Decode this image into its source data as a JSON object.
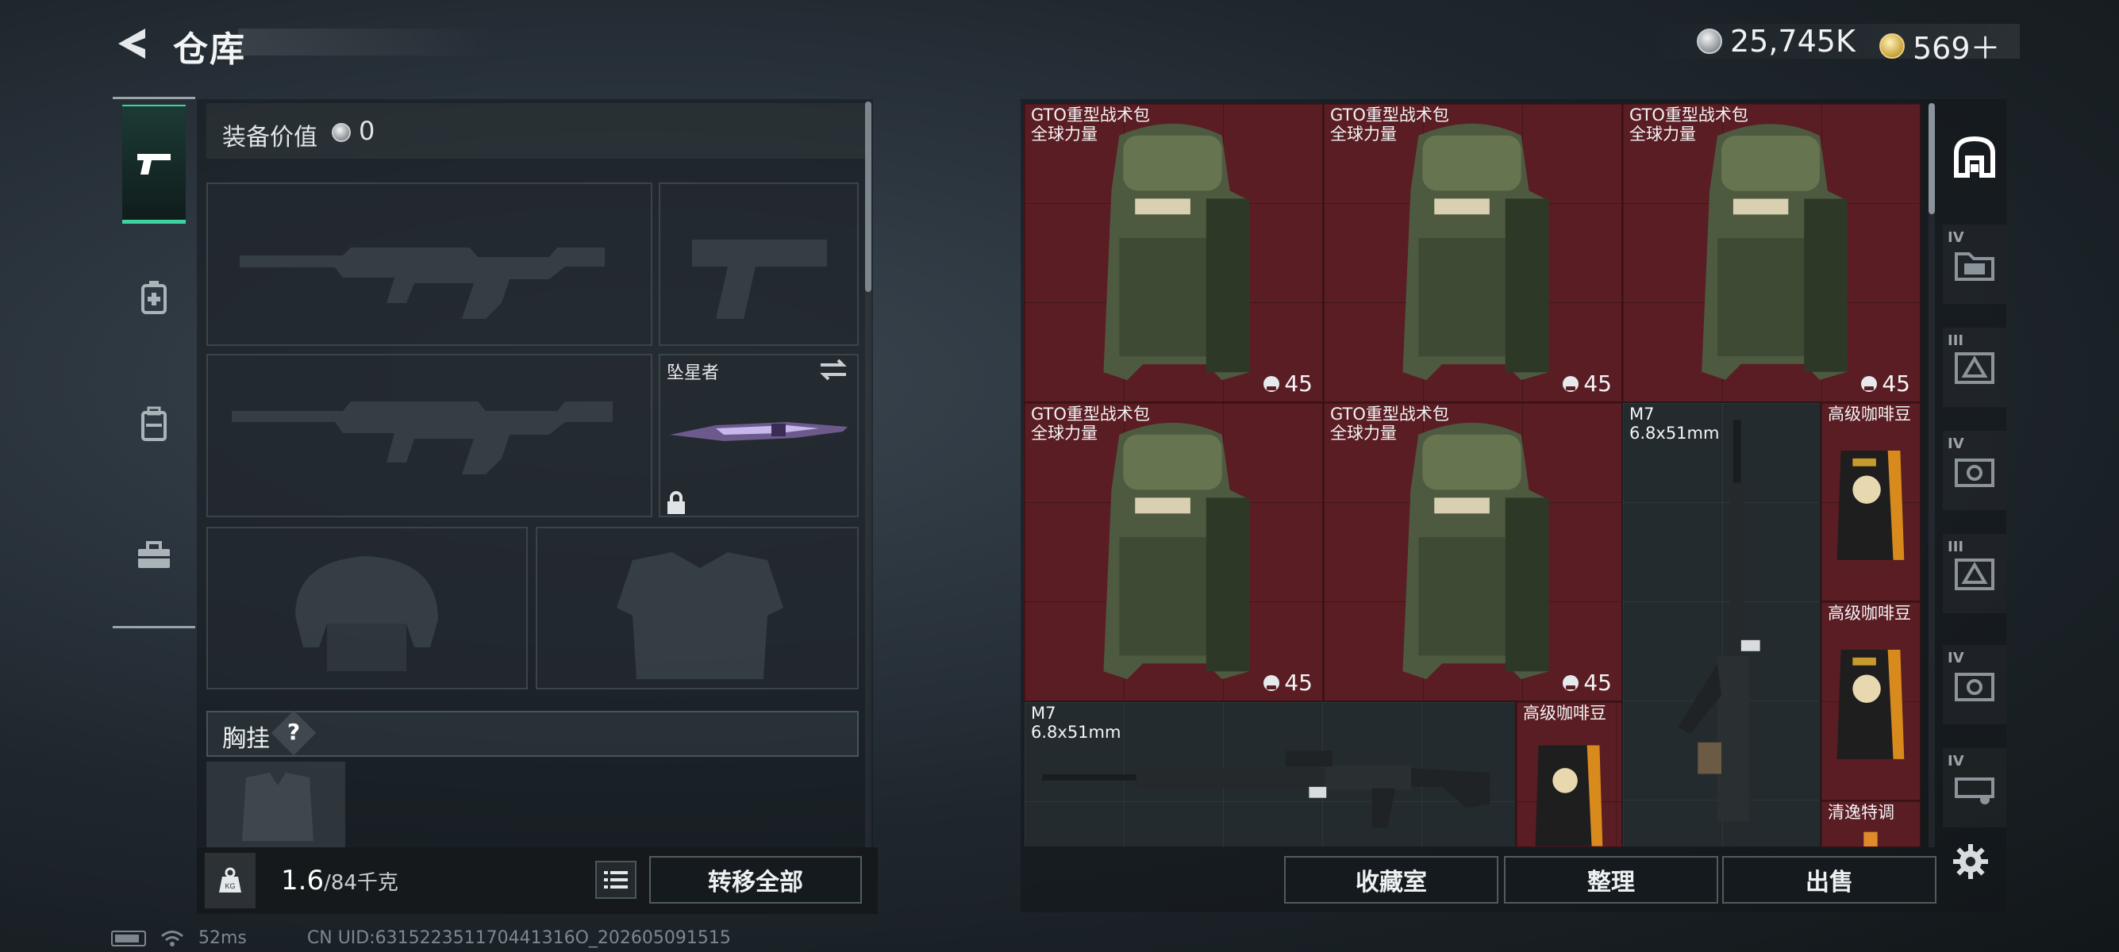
{
  "header": {
    "title": "仓库",
    "currency": [
      {
        "icon": "silver-coin-icon",
        "value": "25,745K"
      },
      {
        "icon": "gold-coin-icon",
        "value": "569＋"
      }
    ]
  },
  "categories": [
    {
      "name": "weapons",
      "icon": "pistol-icon",
      "active": true
    },
    {
      "name": "medical",
      "icon": "medkit-icon",
      "active": false
    },
    {
      "name": "backpack",
      "icon": "backpack-icon",
      "active": false
    },
    {
      "name": "toolbox",
      "icon": "toolbox-icon",
      "active": false
    }
  ],
  "equipment": {
    "value_label": "装备价值",
    "value": "0",
    "melee_slot_name": "坠星者",
    "chest_label": "胸挂",
    "help": "?"
  },
  "weight": {
    "current": "1.6",
    "rest": "/84千克"
  },
  "buttons": {
    "transfer_all": "转移全部",
    "collection": "收藏室",
    "sort": "整理",
    "sell": "出售"
  },
  "stash": {
    "items": [
      {
        "name": "GTO重型战术包",
        "sub": "全球力量",
        "count": "45"
      },
      {
        "name": "GTO重型战术包",
        "sub": "全球力量",
        "count": "45"
      },
      {
        "name": "GTO重型战术包",
        "sub": "全球力量",
        "count": "45"
      },
      {
        "name": "GTO重型战术包",
        "sub": "全球力量",
        "count": "45"
      },
      {
        "name": "GTO重型战术包",
        "sub": "全球力量",
        "count": "45"
      },
      {
        "name": "M7",
        "sub": "6.8x51mm"
      },
      {
        "name": "高级咖啡豆"
      },
      {
        "name": "高级咖啡豆"
      },
      {
        "name": "M7",
        "sub": "6.8x51mm"
      },
      {
        "name": "高级咖啡豆"
      },
      {
        "name": "清逸特调"
      }
    ]
  },
  "side_tabs": [
    {
      "icon": "stash-main-icon",
      "label": ""
    },
    {
      "icon": "stash-folder-icon",
      "label": "IV"
    },
    {
      "icon": "stash-triangle-icon",
      "label": "III"
    },
    {
      "icon": "stash-camera-icon",
      "label": "IV"
    },
    {
      "icon": "stash-triangle-icon",
      "label": "III"
    },
    {
      "icon": "stash-camera-icon",
      "label": "IV"
    },
    {
      "icon": "stash-vehicle-icon",
      "label": "IV"
    }
  ],
  "status": {
    "ping": "52ms",
    "uid": "CN UID:631522351170441316O_202605091515"
  },
  "colors": {
    "accent": "#3ed2a0",
    "item_bg_red": "#5a1d23",
    "item_bg_gray": "#242b2f"
  }
}
